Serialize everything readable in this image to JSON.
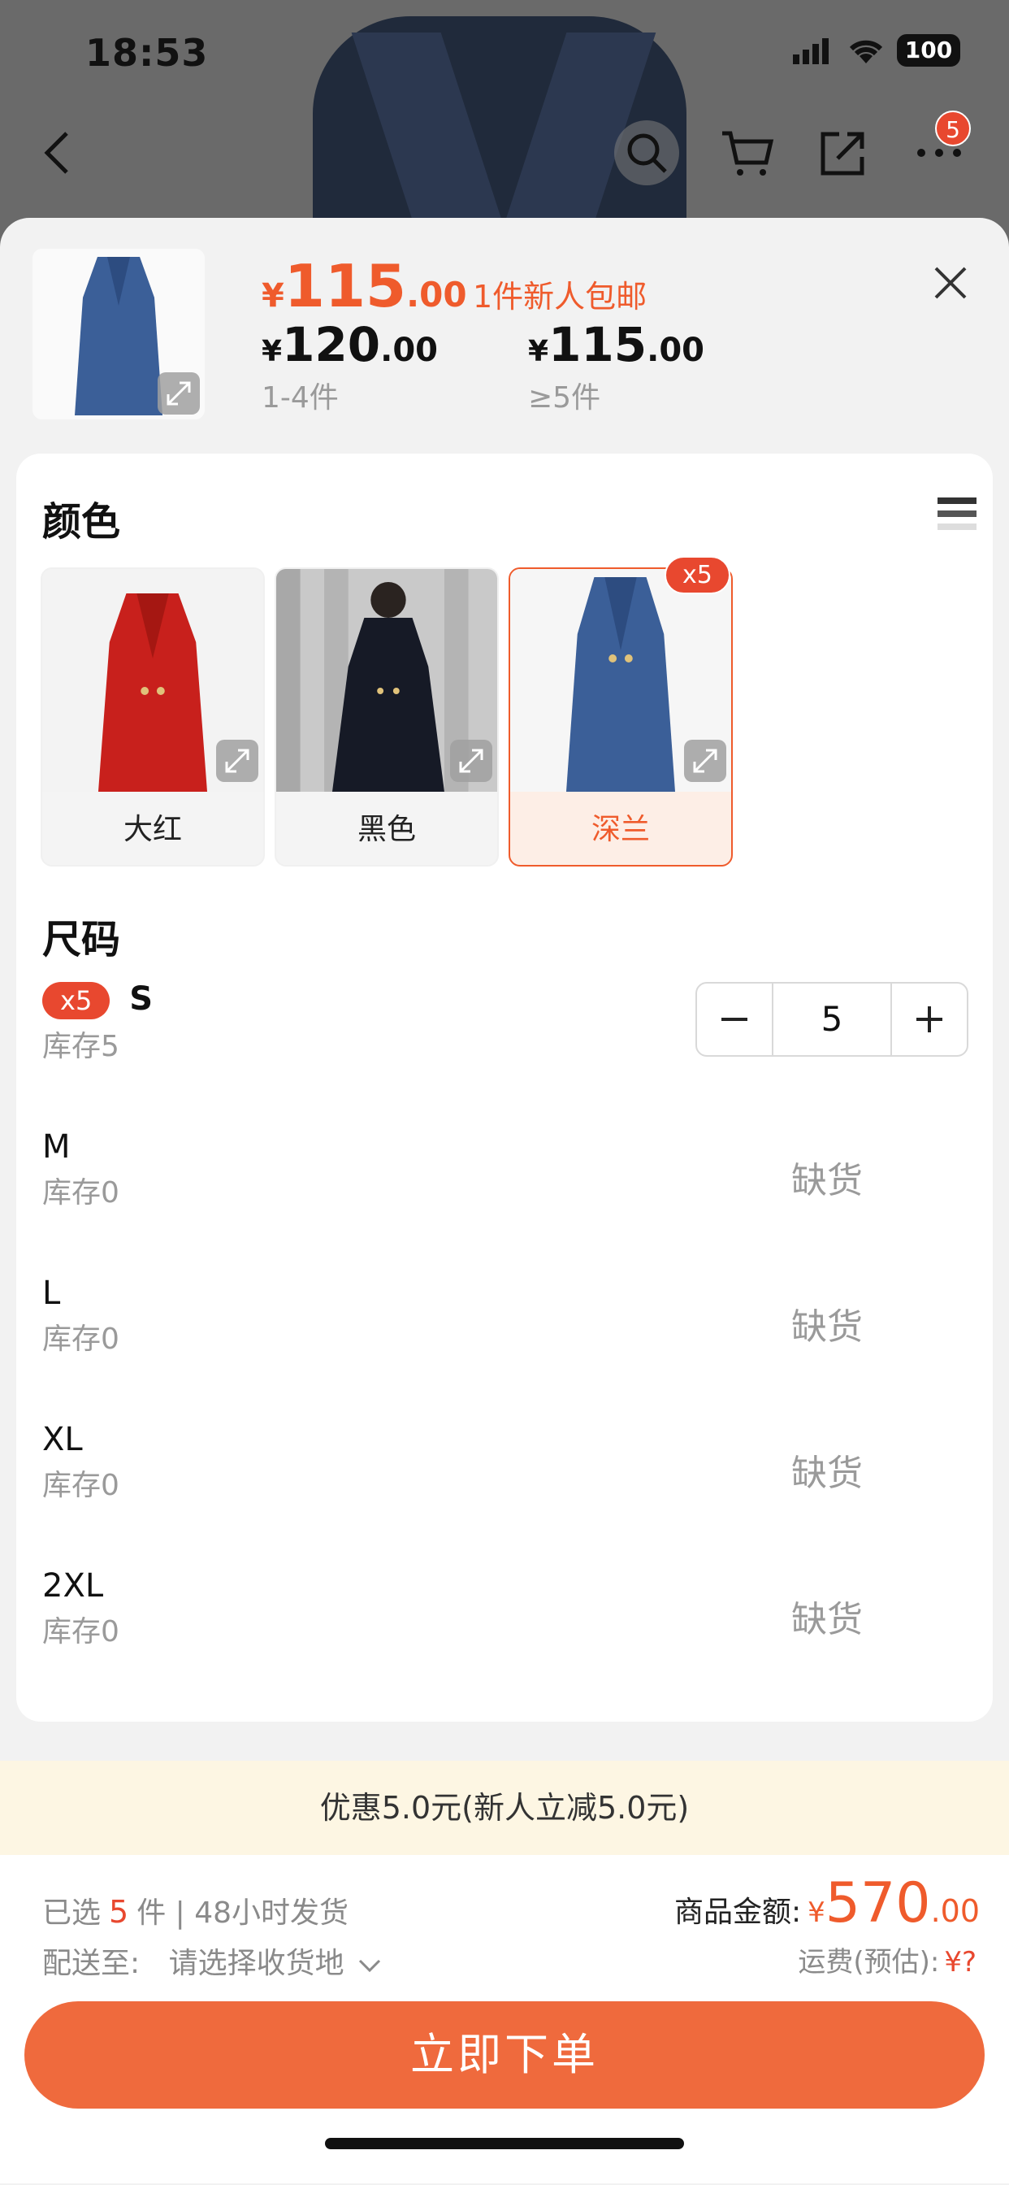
{
  "status": {
    "time": "18:53",
    "battery": "100"
  },
  "nav": {
    "cart_badge": "5"
  },
  "product": {
    "price_yen": "¥",
    "price_int": "115",
    "price_dec": ".00",
    "promo": "1件新人包邮",
    "tiers": [
      {
        "yen": "¥",
        "int": "120",
        "dec": ".00",
        "qty": "1-4件"
      },
      {
        "yen": "¥",
        "int": "115",
        "dec": ".00",
        "qty": "≥5件"
      }
    ]
  },
  "color_section": {
    "title": "颜色",
    "options": [
      {
        "label": "大红",
        "swatch": "#c8201c",
        "selected": false
      },
      {
        "label": "黑色",
        "swatch": "#161a26",
        "selected": false
      },
      {
        "label": "深兰",
        "swatch": "#3b5f98",
        "selected": true,
        "badge": "x5"
      }
    ]
  },
  "size_section": {
    "title": "尺码",
    "sizes": [
      {
        "name": "S",
        "stock": "库存5",
        "badge": "x5",
        "qty": "5"
      },
      {
        "name": "M",
        "stock": "库存0",
        "status": "缺货"
      },
      {
        "name": "L",
        "stock": "库存0",
        "status": "缺货"
      },
      {
        "name": "XL",
        "stock": "库存0",
        "status": "缺货"
      },
      {
        "name": "2XL",
        "stock": "库存0",
        "status": "缺货"
      }
    ]
  },
  "discount": "优惠5.0元(新人立减5.0元)",
  "summary": {
    "selected_prefix": "已选",
    "selected_count": "5",
    "selected_suffix": "件 | 48小时发货",
    "ship_label": "配送至:",
    "ship_value": "请选择收货地",
    "amount_label": "商品金额:",
    "amount_yen": "¥",
    "amount_int": "570",
    "amount_dec": ".00",
    "freight_label": "运费(预估):",
    "freight_value": "¥?"
  },
  "order_button": "立即下单",
  "colors": {
    "accent": "#ef5b2c",
    "badge": "#e8482f",
    "button": "#ef6a3d",
    "discount_bg": "#fdf6e3"
  }
}
